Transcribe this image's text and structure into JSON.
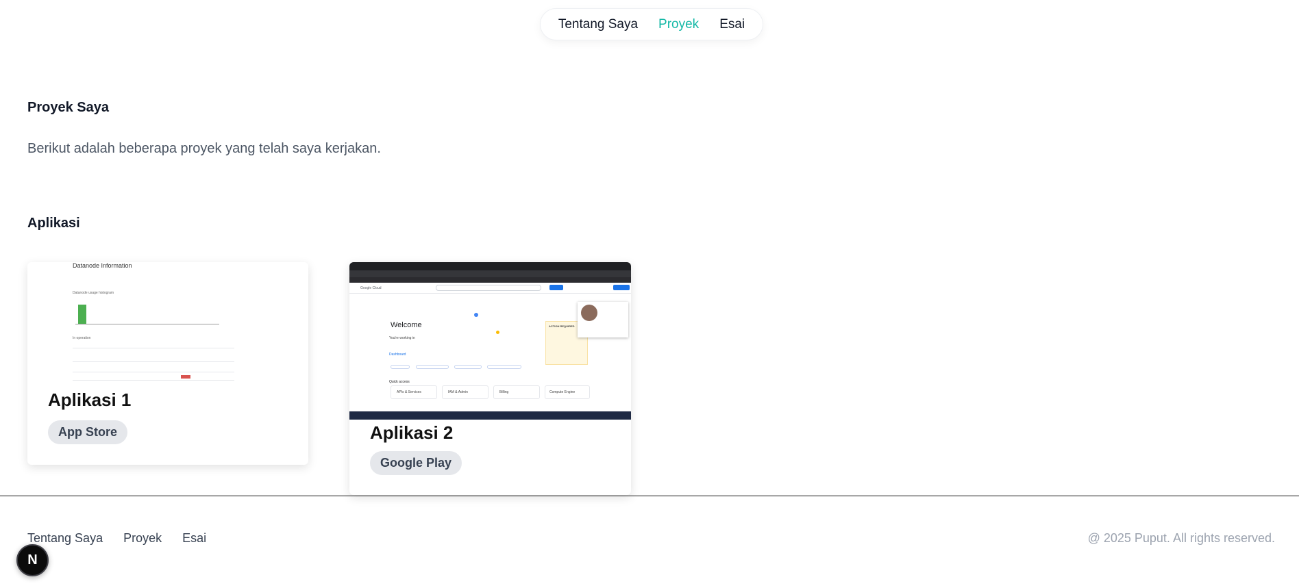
{
  "nav": {
    "items": [
      {
        "label": "Tentang Saya",
        "active": false
      },
      {
        "label": "Proyek",
        "active": true
      },
      {
        "label": "Esai",
        "active": false
      }
    ],
    "active_color": "#14b8a6"
  },
  "main": {
    "heading": "Proyek Saya",
    "intro": "Berikut adalah beberapa proyek yang telah saya kerjakan.",
    "section_title": "Aplikasi",
    "cards": [
      {
        "title": "Aplikasi 1",
        "badge": "App Store",
        "thumbnail": {
          "title": "Datanode Information",
          "histogram_label": "Datanode usage histogram",
          "operation_label": "In operation"
        }
      },
      {
        "title": "Aplikasi 2",
        "badge": "Google Play",
        "thumbnail": {
          "brand": "Google Cloud",
          "welcome": "Welcome",
          "working_in": "You're working in",
          "quick_access": "Quick access",
          "action_required": "ACTION REQUIRED",
          "tiles": [
            "APIs & Services",
            "IAM & Admin",
            "Billing",
            "Compute Engine"
          ]
        }
      }
    ]
  },
  "footer": {
    "links": [
      "Tentang Saya",
      "Proyek",
      "Esai"
    ],
    "copyright": "@ 2025 Puput. All rights reserved."
  },
  "dev_badge": {
    "letter": "N"
  }
}
